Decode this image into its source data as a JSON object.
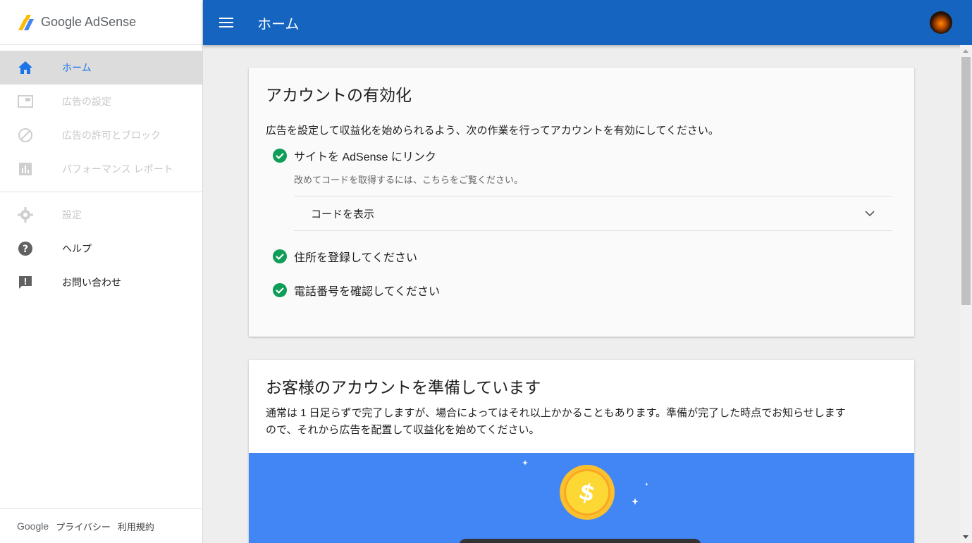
{
  "brand": {
    "name": "Google AdSense"
  },
  "sidebar": {
    "items": [
      {
        "label": "ホーム",
        "icon": "home-icon",
        "state": "active"
      },
      {
        "label": "広告の設定",
        "icon": "ad-unit-icon",
        "state": "disabled"
      },
      {
        "label": "広告の許可とブロック",
        "icon": "block-icon",
        "state": "disabled"
      },
      {
        "label": "パフォーマンス レポート",
        "icon": "bar-chart-icon",
        "state": "disabled"
      },
      {
        "label": "設定",
        "icon": "gear-icon",
        "state": "disabled"
      },
      {
        "label": "ヘルプ",
        "icon": "help-icon",
        "state": "normal"
      },
      {
        "label": "お問い合わせ",
        "icon": "feedback-icon",
        "state": "normal"
      }
    ],
    "footer": {
      "google": "Google",
      "privacy": "プライバシー",
      "terms": "利用規約"
    }
  },
  "header": {
    "title": "ホーム"
  },
  "activation_card": {
    "title": "アカウントの有効化",
    "description": "広告を設定して収益化を始められるよう、次の作業を行ってアカウントを有効にしてください。",
    "task1": "サイトを AdSense にリンク",
    "task1_hint": "改めてコードを取得するには、こちらをご覧ください。",
    "expander_label": "コードを表示",
    "task2": "住所を登録してください",
    "task3": "電話番号を確認してください"
  },
  "preparing_card": {
    "title": "お客様のアカウントを準備しています",
    "description_line1": "通常は 1 日足らずで完了しますが、場合によってはそれ以上かかることもあります。準備が完了した時点でお知らせします",
    "description_line2": "ので、それから広告を配置して収益化を始めてください。"
  },
  "colors": {
    "header": "#1565c0",
    "accent": "#1a73e8",
    "success": "#0f9d58",
    "banner": "#4285f4",
    "coin": "#fbc02d"
  }
}
